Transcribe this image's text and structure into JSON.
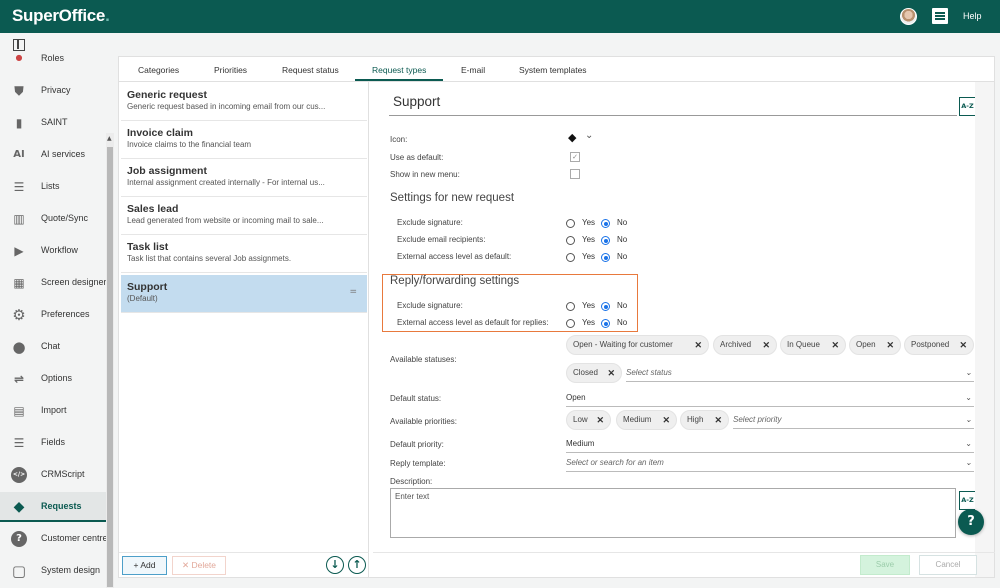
{
  "header": {
    "logo": "SuperOffice",
    "logo_dot": ".",
    "help_label": "Help"
  },
  "sidebar": {
    "items": [
      {
        "label": "Roles",
        "icon": "roles-icon"
      },
      {
        "label": "Privacy",
        "icon": "shield-icon"
      },
      {
        "label": "SAINT",
        "icon": "chart-icon"
      },
      {
        "label": "AI services",
        "icon": "ai-icon"
      },
      {
        "label": "Lists",
        "icon": "list-icon"
      },
      {
        "label": "Quote/Sync",
        "icon": "barcode-icon"
      },
      {
        "label": "Workflow",
        "icon": "workflow-icon"
      },
      {
        "label": "Screen designer",
        "icon": "screen-designer-icon"
      },
      {
        "label": "Preferences",
        "icon": "gear-icon"
      },
      {
        "label": "Chat",
        "icon": "chat-icon"
      },
      {
        "label": "Options",
        "icon": "sliders-icon"
      },
      {
        "label": "Import",
        "icon": "import-icon"
      },
      {
        "label": "Fields",
        "icon": "fields-icon"
      },
      {
        "label": "CRMScript",
        "icon": "code-icon"
      },
      {
        "label": "Requests",
        "icon": "ticket-icon",
        "active": true
      },
      {
        "label": "Customer centre",
        "icon": "question-icon"
      },
      {
        "label": "System design",
        "icon": "system-design-icon"
      }
    ],
    "glyphs": {
      "ai": "AI",
      "lists": "☰",
      "quote": "▥",
      "screen": "▦",
      "gear": "⚙",
      "chat": "●",
      "options": "⇌",
      "import": "▤",
      "fields": "☰",
      "code": "</>",
      "question": "?",
      "system": "▢",
      "shield": "⛊",
      "chart": "▮",
      "roles": "●",
      "workflow": "▶",
      "ticket": "◆"
    }
  },
  "tabs": [
    {
      "label": "Categories"
    },
    {
      "label": "Priorities"
    },
    {
      "label": "Request status"
    },
    {
      "label": "Request types",
      "active": true
    },
    {
      "label": "E-mail"
    },
    {
      "label": "System templates"
    }
  ],
  "request_types": [
    {
      "title": "Generic request",
      "desc": "Generic request based in incoming email from our cus..."
    },
    {
      "title": "Invoice claim",
      "desc": "Invoice claims to the financial team"
    },
    {
      "title": "Job assignment",
      "desc": "Internal assignment created internally - For internal us..."
    },
    {
      "title": "Sales lead",
      "desc": "Lead generated from website or incoming mail to sale..."
    },
    {
      "title": "Task list",
      "desc": "Task list that contains several Job assignmets."
    },
    {
      "title": "Support",
      "desc": "(Default)",
      "selected": true
    }
  ],
  "list_footer": {
    "add_label": "+ Add",
    "delete_label": "✕ Delete",
    "move_down": "↓",
    "move_up": "↑",
    "grip": "="
  },
  "detail": {
    "name_value": "Support",
    "az_label": "A-Z",
    "icon_label": "Icon:",
    "use_default_label": "Use as default:",
    "use_default_checked": true,
    "show_new_menu_label": "Show in new menu:",
    "show_new_menu_checked": false,
    "check_glyph": "✓",
    "chevron": "⌄",
    "new_request_section": "Settings for new request",
    "new_request_settings": [
      {
        "label": "Exclude signature:",
        "value": "No"
      },
      {
        "label": "Exclude email recipients:",
        "value": "No"
      },
      {
        "label": "External access level as default:",
        "value": "No"
      }
    ],
    "reply_section": "Reply/forwarding settings",
    "reply_settings": [
      {
        "label": "Exclude signature:",
        "value": "No"
      },
      {
        "label": "External access level as default for replies:",
        "value": "No"
      }
    ],
    "yes_label": "Yes",
    "no_label": "No",
    "available_statuses_label": "Available statuses:",
    "available_statuses": [
      "Open - Waiting for customer",
      "Archived",
      "In Queue",
      "Open",
      "Postponed",
      "Closed"
    ],
    "select_status_placeholder": "Select status",
    "default_status_label": "Default status:",
    "default_status": "Open",
    "available_priorities_label": "Available priorities:",
    "available_priorities": [
      "Low",
      "Medium",
      "High"
    ],
    "select_priority_placeholder": "Select priority",
    "default_priority_label": "Default priority:",
    "default_priority": "Medium",
    "reply_template_label": "Reply template:",
    "reply_template_placeholder": "Select or search for an item",
    "description_label": "Description:",
    "description_placeholder": "Enter text",
    "chip_x": "✕",
    "help_fab": "?",
    "save_label": "Save",
    "cancel_label": "Cancel"
  },
  "colors": {
    "brand": "#0b5a51",
    "highlight": "#e8793d",
    "radio_on": "#1a73e8",
    "selected_row": "#c3dcef"
  }
}
